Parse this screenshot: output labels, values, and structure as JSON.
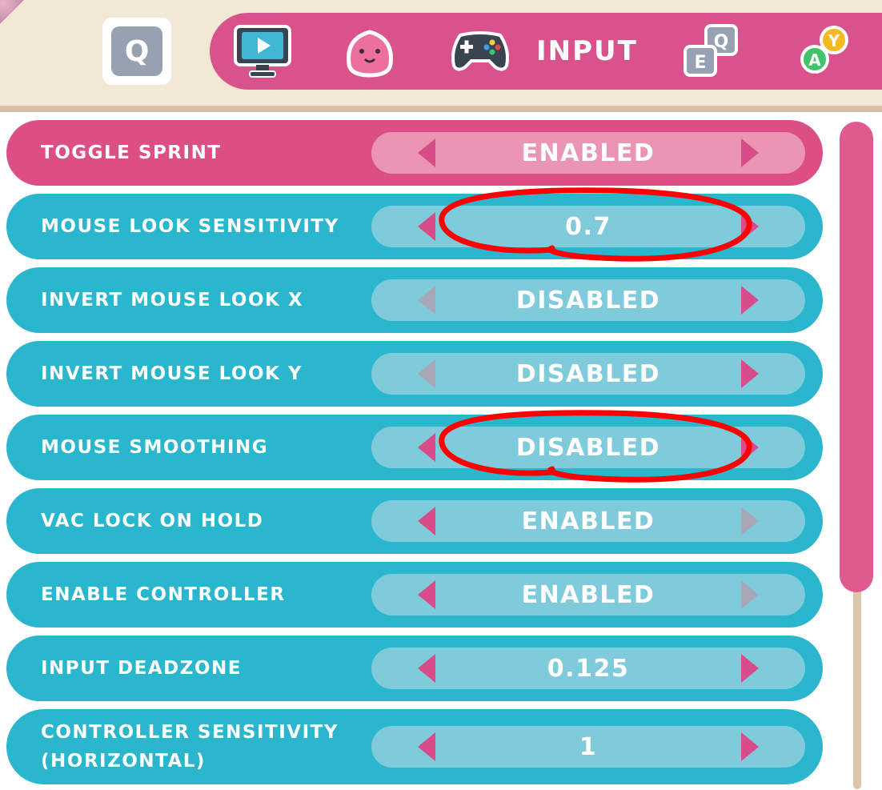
{
  "header": {
    "left_key": "Q",
    "active_tab_label": "INPUT",
    "tabs": [
      {
        "icon": "monitor-play-icon"
      },
      {
        "icon": "slime-icon"
      },
      {
        "icon": "gamepad-icon"
      },
      {
        "icon": "eq-keys-icon",
        "text_a": "Q",
        "text_b": "E"
      },
      {
        "icon": "ay-buttons-icon",
        "text_a": "Y",
        "text_b": "A"
      }
    ]
  },
  "settings": [
    {
      "label": "TOGGLE SPRINT",
      "value": "ENABLED",
      "selected": true
    },
    {
      "label": "MOUSE LOOK SENSITIVITY",
      "value": "0.7"
    },
    {
      "label": "INVERT MOUSE LOOK X",
      "value": "DISABLED"
    },
    {
      "label": "INVERT MOUSE LOOK Y",
      "value": "DISABLED"
    },
    {
      "label": "MOUSE SMOOTHING",
      "value": "DISABLED"
    },
    {
      "label": "VAC LOCK ON HOLD",
      "value": "ENABLED"
    },
    {
      "label": "ENABLE CONTROLLER",
      "value": "ENABLED"
    },
    {
      "label": "INPUT DEADZONE",
      "value": "0.125"
    },
    {
      "label": "CONTROLLER SENSITIVITY\n(HORIZONTAL)",
      "value": "1"
    }
  ],
  "colors": {
    "row_bg": "#2ab6cc",
    "row_selected_bg": "#dc4f86",
    "arrow_active": "#d94c8a",
    "arrow_disabled": "#a8a7b6",
    "annotation": "#ff0000"
  }
}
